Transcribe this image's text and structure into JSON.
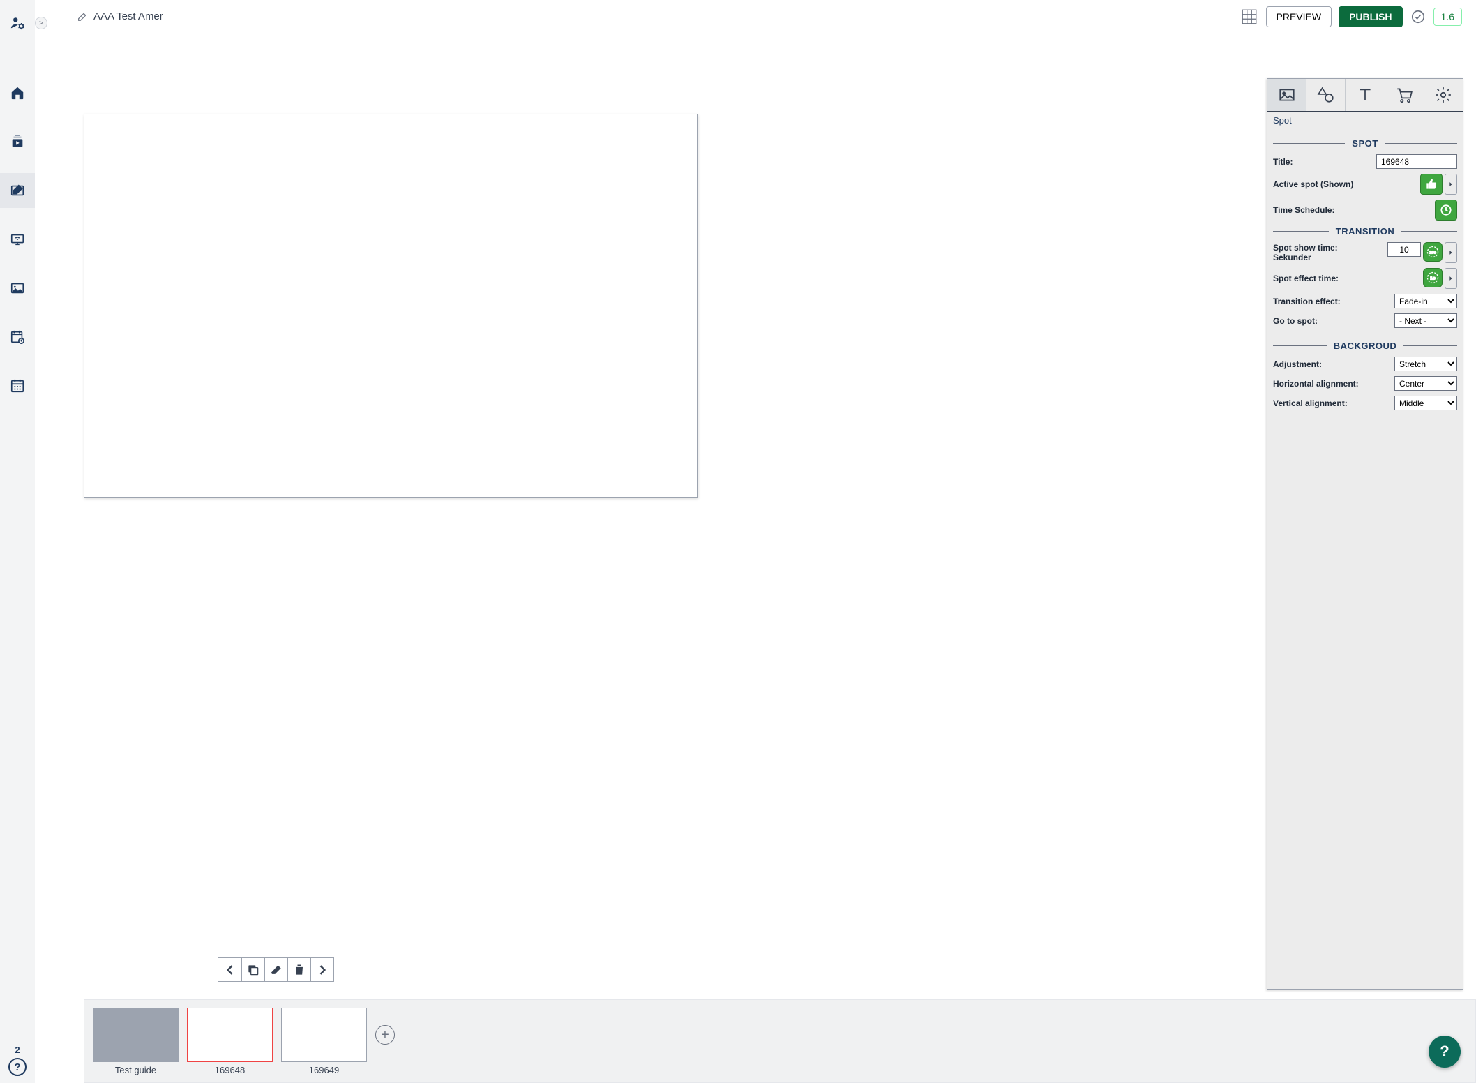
{
  "sidenav": {
    "badge": "2",
    "toggle": ">"
  },
  "header": {
    "title": "AAA Test Amer",
    "preview_label": "PREVIEW",
    "publish_label": "PUBLISH",
    "version": "1.6"
  },
  "panel": {
    "tab_label": "Spot",
    "sections": {
      "spot": {
        "heading": "SPOT",
        "title_label": "Title:",
        "title_value": "169648",
        "active_label": "Active spot (Shown)",
        "schedule_label": "Time Schedule:"
      },
      "transition": {
        "heading": "TRANSITION",
        "showtime_label": "Spot show time:",
        "showtime_sub": "Sekunder",
        "showtime_value": "10",
        "effecttime_label": "Spot effect time:",
        "effect_label": "Transition effect:",
        "effect_value": "Fade-in",
        "goto_label": "Go to spot:",
        "goto_value": "- Next -"
      },
      "background": {
        "heading": "BACKGROUD",
        "adjust_label": "Adjustment:",
        "adjust_value": "Stretch",
        "halign_label": "Horizontal alignment:",
        "halign_value": "Center",
        "valign_label": "Vertical alignment:",
        "valign_value": "Middle"
      }
    }
  },
  "thumbs": [
    {
      "label": "Test guide"
    },
    {
      "label": "169648"
    },
    {
      "label": "169649"
    }
  ],
  "help": {
    "glyph": "?"
  }
}
